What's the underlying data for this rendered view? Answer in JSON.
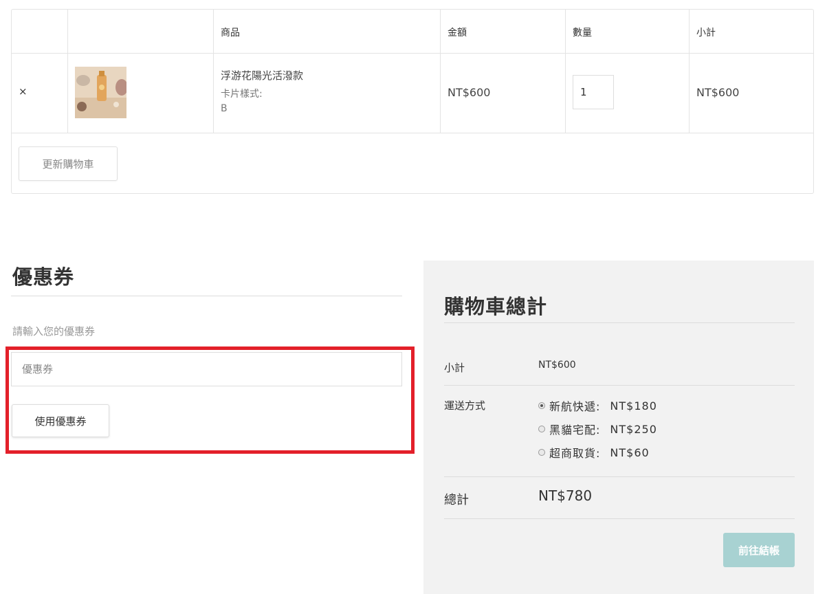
{
  "cart": {
    "headers": [
      "",
      "",
      "商品",
      "金額",
      "數量",
      "小計"
    ],
    "item": {
      "remove_symbol": "×",
      "name": "浮游花陽光活潑款",
      "option_label": "卡片樣式:",
      "option_value": "B",
      "price": "NT$600",
      "quantity": "1",
      "subtotal": "NT$600"
    },
    "update_button": "更新購物車"
  },
  "coupon": {
    "title": "優惠券",
    "hint": "請輸入您的優惠券",
    "input_placeholder": "優惠券",
    "apply_button": "使用優惠券",
    "highlight_color": "#e3202a"
  },
  "totals": {
    "title": "購物車總計",
    "subtotal_label": "小計",
    "subtotal_value": "NT$600",
    "shipping_label": "運送方式",
    "shipping_options": [
      {
        "name": "新航快遞:",
        "price": "NT$180",
        "selected": true
      },
      {
        "name": "黑貓宅配:",
        "price": "NT$250",
        "selected": false
      },
      {
        "name": "超商取貨:",
        "price": "NT$60",
        "selected": false
      }
    ],
    "total_label": "總計",
    "total_value": "NT$780",
    "checkout_button": "前往結帳",
    "checkout_color": "#a8d2d2"
  }
}
